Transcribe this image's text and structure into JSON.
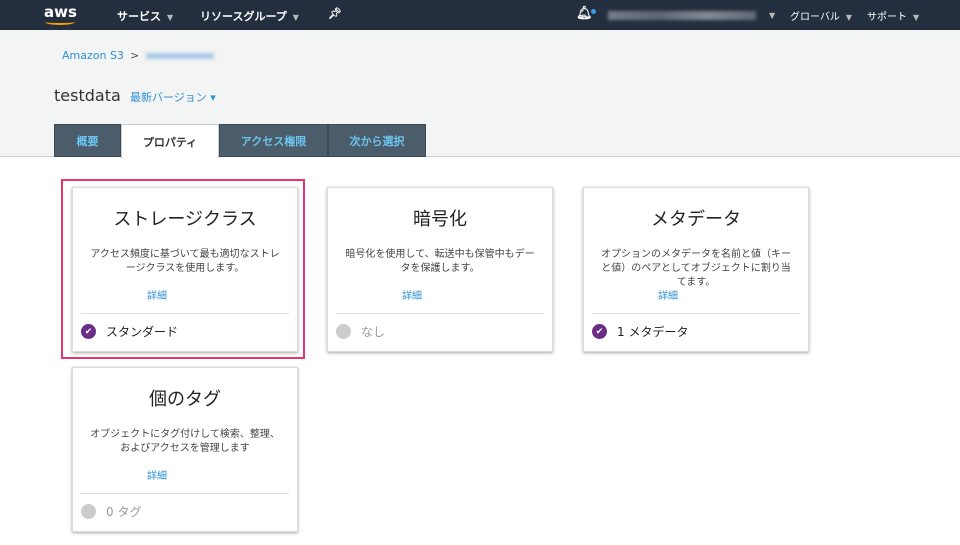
{
  "topbar": {
    "logo": "aws",
    "services": "サービス",
    "resource_groups": "リソースグループ",
    "region": "グローバル",
    "support": "サポート"
  },
  "breadcrumb": {
    "root": "Amazon S3",
    "separator": ">"
  },
  "object": {
    "name": "testdata",
    "version": "最新バージョン ▾"
  },
  "tabs": [
    {
      "label": "概要"
    },
    {
      "label": "プロパティ"
    },
    {
      "label": "アクセス権限"
    },
    {
      "label": "次から選択"
    }
  ],
  "cards": [
    {
      "title": "ストレージクラス",
      "desc": "アクセス頻度に基づいて最も適切なストレージクラスを使用します。",
      "more": "詳細",
      "status": "スタンダード"
    },
    {
      "title": "暗号化",
      "desc": "暗号化を使用して、転送中も保管中もデータを保護します。",
      "more": "詳細",
      "status": "なし"
    },
    {
      "title": "メタデータ",
      "desc": "オプションのメタデータを名前と値（キーと値）のペアとしてオブジェクトに割り当てます。",
      "more": "詳細",
      "status": "1 メタデータ"
    },
    {
      "title": "個のタグ",
      "desc": "オブジェクトにタグ付けして検索、整理、およびアクセスを管理します",
      "more": "詳細",
      "status": "0 タグ"
    }
  ]
}
